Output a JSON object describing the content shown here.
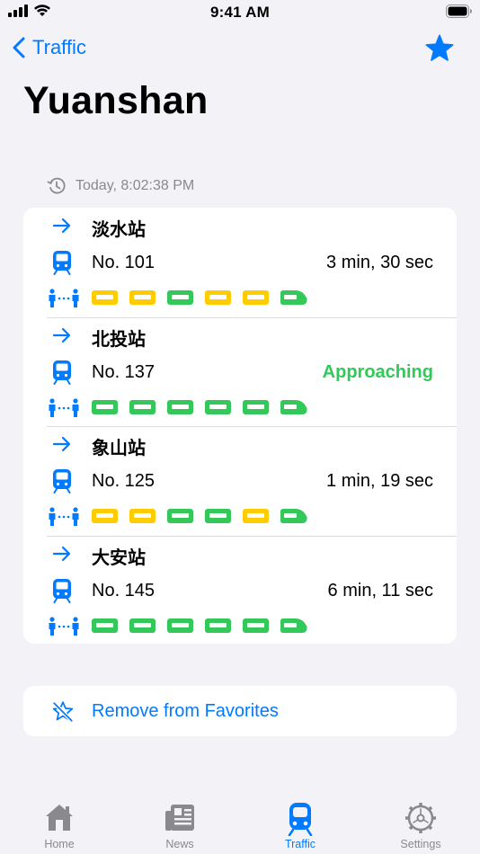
{
  "status_bar": {
    "time": "9:41 AM"
  },
  "nav": {
    "back_label": "Traffic"
  },
  "page": {
    "title": "Yuanshan"
  },
  "timestamp": "Today, 8:02:38 PM",
  "colors": {
    "accent": "#007aff",
    "green": "#34c759",
    "yellow": "#ffcc00",
    "gray": "#8a8a8e"
  },
  "trains": [
    {
      "destination": "淡水站",
      "train_no": "No. 101",
      "eta": "3 min, 30 sec",
      "approaching": false,
      "cars": [
        "yellow",
        "yellow",
        "green",
        "yellow",
        "yellow",
        "green"
      ]
    },
    {
      "destination": "北投站",
      "train_no": "No. 137",
      "eta": "Approaching",
      "approaching": true,
      "cars": [
        "green",
        "green",
        "green",
        "green",
        "green",
        "green"
      ]
    },
    {
      "destination": "象山站",
      "train_no": "No. 125",
      "eta": "1 min, 19 sec",
      "approaching": false,
      "cars": [
        "yellow",
        "yellow",
        "green",
        "green",
        "yellow",
        "green"
      ]
    },
    {
      "destination": "大安站",
      "train_no": "No. 145",
      "eta": "6 min, 11 sec",
      "approaching": false,
      "cars": [
        "green",
        "green",
        "green",
        "green",
        "green",
        "green"
      ]
    }
  ],
  "remove_favorite": {
    "label": "Remove from Favorites"
  },
  "tabs": [
    {
      "label": "Home",
      "icon": "house-icon",
      "active": false
    },
    {
      "label": "News",
      "icon": "newspaper-icon",
      "active": false
    },
    {
      "label": "Traffic",
      "icon": "tram-icon",
      "active": true
    },
    {
      "label": "Settings",
      "icon": "gear-icon",
      "active": false
    }
  ]
}
